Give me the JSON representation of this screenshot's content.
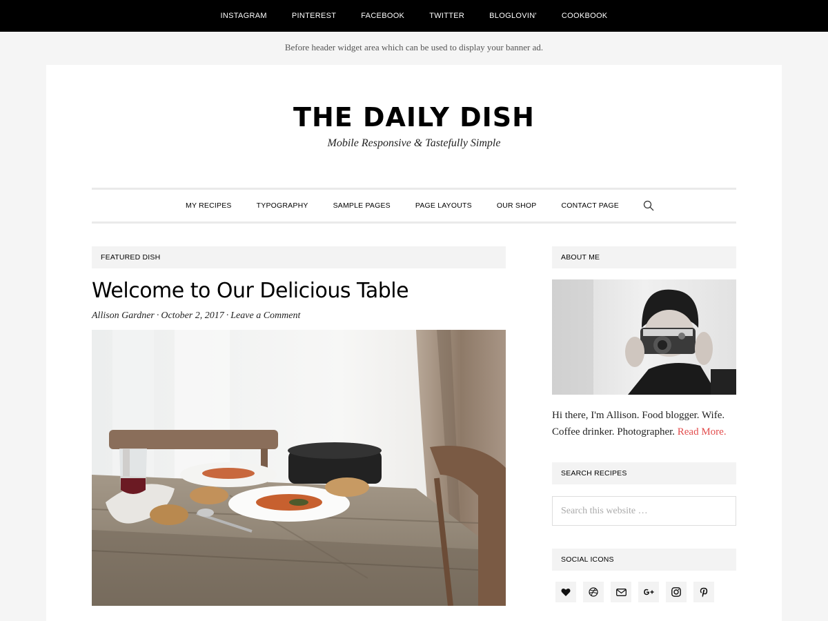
{
  "top_menu": [
    "INSTAGRAM",
    "PINTEREST",
    "FACEBOOK",
    "TWITTER",
    "BLOGLOVIN'",
    "COOKBOOK"
  ],
  "banner_note": "Before header widget area which can be used to display your banner ad.",
  "site": {
    "title": "THE DAILY DISH",
    "tagline": "Mobile Responsive & Tastefully Simple"
  },
  "nav": {
    "items": [
      "MY RECIPES",
      "TYPOGRAPHY",
      "SAMPLE PAGES",
      "PAGE LAYOUTS",
      "OUR SHOP",
      "CONTACT PAGE"
    ],
    "search_icon": "search-icon"
  },
  "main": {
    "section_label": "FEATURED DISH",
    "post": {
      "title": "Welcome to Our Delicious Table",
      "author": "Allison Gardner",
      "separator": "·",
      "date": "October 2, 2017",
      "comment_link": "Leave a Comment",
      "image_icon": "dining-table-photo"
    }
  },
  "sidebar": {
    "about": {
      "title": "ABOUT ME",
      "photo_icon": "woman-with-camera-photo",
      "text": "Hi there, I'm Allison. Food blogger. Wife. Coffee drinker. Photographer.",
      "read_more": "Read More."
    },
    "search": {
      "title": "SEARCH RECIPES",
      "placeholder": "Search this website …"
    },
    "social": {
      "title": "SOCIAL ICONS",
      "icons": [
        "heart-icon",
        "dribbble-icon",
        "mail-icon",
        "google-plus-icon",
        "instagram-icon",
        "pinterest-icon"
      ]
    }
  },
  "colors": {
    "topbar_bg": "#000000",
    "accent_link": "#e24b4b",
    "widget_bg": "#f3f3f3",
    "page_bg": "#f5f5f5"
  }
}
